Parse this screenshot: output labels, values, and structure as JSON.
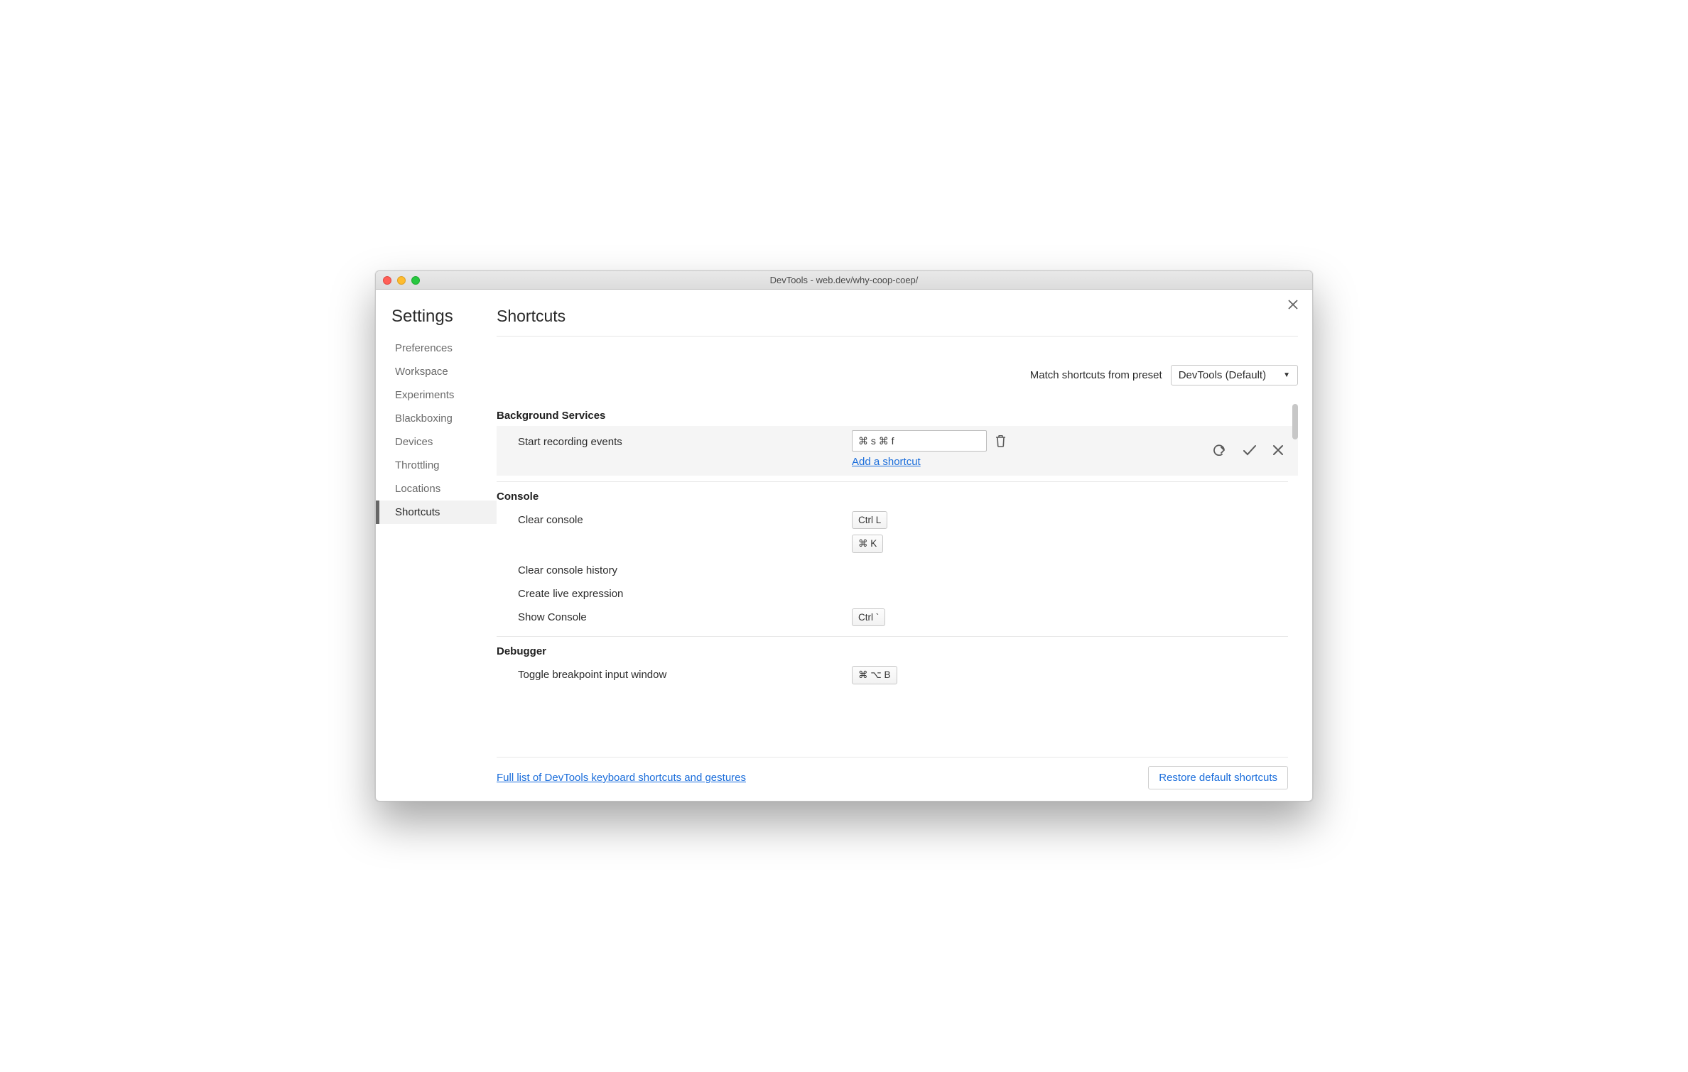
{
  "window_title": "DevTools - web.dev/why-coop-coep/",
  "sidebar": {
    "title": "Settings",
    "items": [
      {
        "label": "Preferences"
      },
      {
        "label": "Workspace"
      },
      {
        "label": "Experiments"
      },
      {
        "label": "Blackboxing"
      },
      {
        "label": "Devices"
      },
      {
        "label": "Throttling"
      },
      {
        "label": "Locations"
      },
      {
        "label": "Shortcuts",
        "active": true
      }
    ]
  },
  "main": {
    "title": "Shortcuts",
    "preset_label": "Match shortcuts from preset",
    "preset_value": "DevTools (Default)",
    "sections": [
      {
        "title": "Background Services",
        "rows": [
          {
            "label": "Start recording events",
            "editing": true,
            "edit_value": "⌘ s ⌘ f",
            "add_link": "Add a shortcut"
          }
        ]
      },
      {
        "title": "Console",
        "rows": [
          {
            "label": "Clear console",
            "keys": [
              "Ctrl L",
              "⌘ K"
            ]
          },
          {
            "label": "Clear console history",
            "keys": []
          },
          {
            "label": "Create live expression",
            "keys": []
          },
          {
            "label": "Show Console",
            "keys": [
              "Ctrl `"
            ]
          }
        ]
      },
      {
        "title": "Debugger",
        "rows": [
          {
            "label": "Toggle breakpoint input window",
            "keys": [
              "⌘ ⌥ B"
            ]
          }
        ]
      }
    ],
    "footer_link": "Full list of DevTools keyboard shortcuts and gestures",
    "restore_button": "Restore default shortcuts"
  }
}
